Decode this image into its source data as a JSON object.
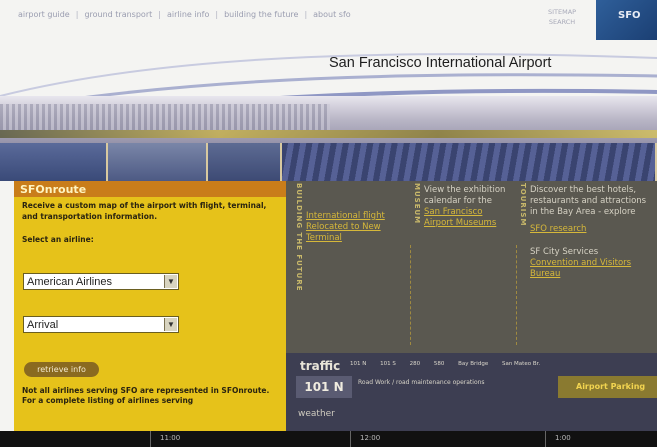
{
  "nav": {
    "links": [
      "airport guide",
      "ground transport",
      "airline info",
      "building the future",
      "about sfo"
    ],
    "utility": [
      "SITEMAP",
      "SEARCH"
    ],
    "badge": "SFO"
  },
  "site_title": "San Francisco International Airport",
  "sfonroute": {
    "heading": "SFOnroute",
    "intro": "Receive a custom map of the airport with flight, terminal, and transportation information.",
    "select_label": "Select an airline:",
    "airline_value": "American Airlines",
    "direction_value": "Arrival",
    "button": "retrieve info",
    "note1": "Not all airlines serving SFO are represented in SFOnroute.",
    "note2": "For a complete listing of airlines serving"
  },
  "sections": {
    "building": {
      "vertical_label": "BUILDING THE FUTURE",
      "link": "International flight Relocated to New Terminal"
    },
    "museum": {
      "vertical_label": "MUSEUM",
      "text": "View the exhibition calendar for the",
      "link": "San Francisco Airport Museums"
    },
    "tourism": {
      "vertical_label": "TOURISM",
      "text": "Discover the best hotels, restaurants and attractions in the Bay Area - explore",
      "link1": "SFO research",
      "text2": "SF City Services",
      "link2": "Convention and Visitors Bureau"
    }
  },
  "traffic": {
    "title": "traffic",
    "routes": [
      "101 N",
      "101 S",
      "280",
      "580",
      "Bay Bridge",
      "San Mateo Br."
    ],
    "route_shown": "101 N",
    "status": "Road Work / road maintenance operations",
    "parking": "Airport Parking",
    "weather": "weather"
  },
  "timeline": [
    "11:00",
    "12:00",
    "1:00"
  ],
  "colors": {
    "accent_yellow": "#e6c21a",
    "header_orange": "#c97d1a",
    "dark_panel": "#5a5850",
    "link_gold": "#d6b83a"
  }
}
